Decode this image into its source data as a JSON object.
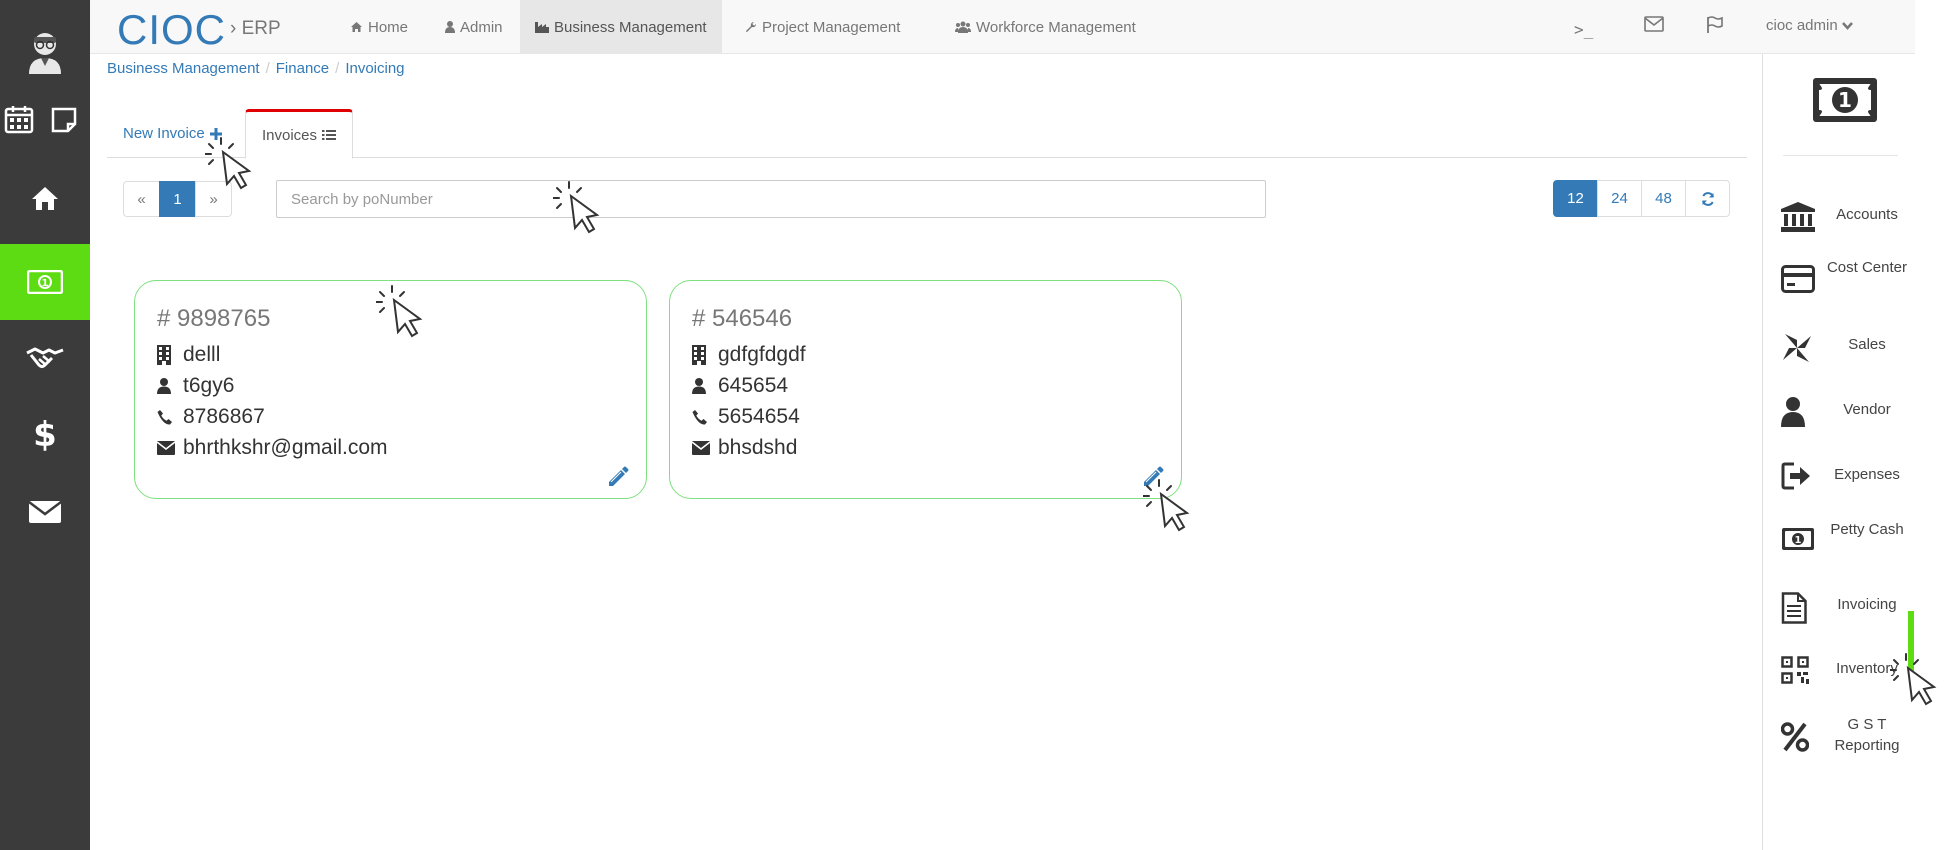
{
  "brand": {
    "name": "CIOC",
    "sub": "› ERP"
  },
  "nav": {
    "home": "Home",
    "admin": "Admin",
    "business_management": "Business Management",
    "project_management": "Project Management",
    "workforce_management": "Workforce Management"
  },
  "topbar": {
    "terminal": ">_",
    "user": "cioc admin"
  },
  "breadcrumb": [
    "Business Management",
    "Finance",
    "Invoicing"
  ],
  "tabs": {
    "new_invoice": "New Invoice",
    "invoices": "Invoices"
  },
  "pager": {
    "prev": "«",
    "current": "1",
    "next": "»"
  },
  "search": {
    "placeholder": "Search by poNumber",
    "value": ""
  },
  "page_sizes": [
    "12",
    "24",
    "48"
  ],
  "active_page_size": "12",
  "cards": [
    {
      "number": "# 9898765",
      "company": "delll",
      "contact": "t6gy6",
      "phone": "8786867",
      "email": "bhrthkshr@gmail.com"
    },
    {
      "number": "# 546546",
      "company": "gdfgfdgdf",
      "contact": "645654",
      "phone": "5654654",
      "email": "bhsdshd"
    }
  ],
  "right_menu": {
    "accounts": "Accounts",
    "cost_center": "Cost Center",
    "sales": "Sales",
    "vendor": "Vendor",
    "expenses": "Expenses",
    "petty_cash": "Petty Cash",
    "invoicing": "Invoicing",
    "inventory": "Inventory",
    "gst_reporting": "G S T Reporting"
  },
  "colors": {
    "accent": "#337ab7",
    "active_green": "#5ddc14",
    "sidebar": "#3b3b3b",
    "tab_active_border": "#e00000",
    "card_border": "#7ee07e"
  }
}
